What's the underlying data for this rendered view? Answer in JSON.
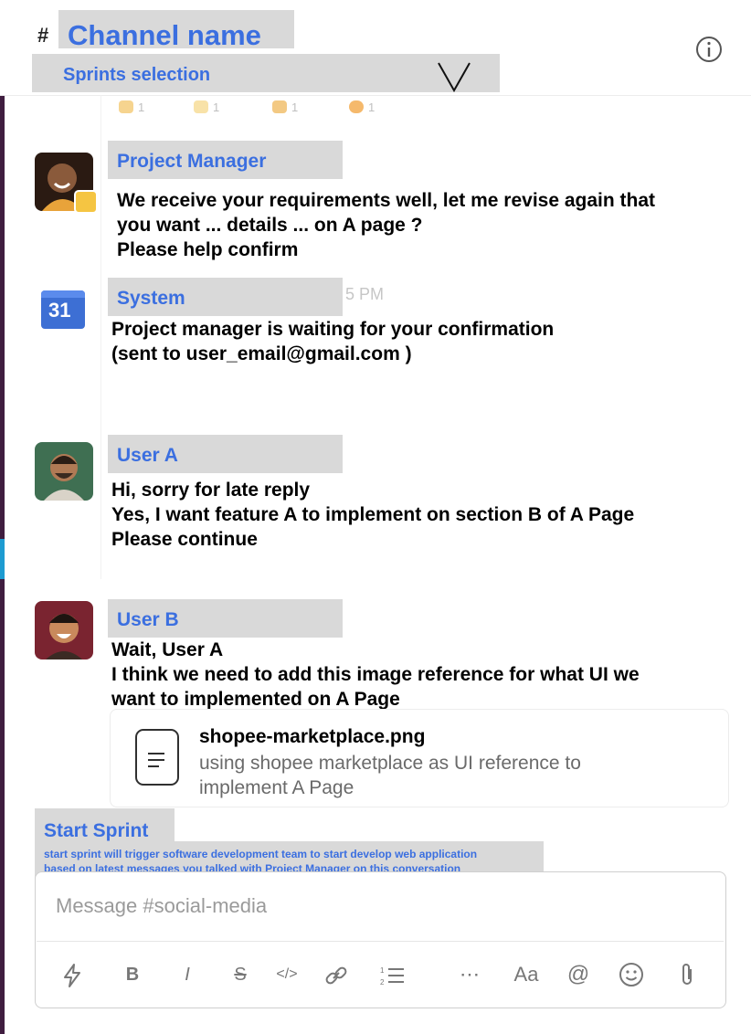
{
  "header": {
    "hash": "#",
    "channel_name": "Channel name",
    "sprints_selection": "Sprints selection"
  },
  "reactions": [
    "1",
    "1",
    "1",
    "1"
  ],
  "messages": [
    {
      "author": "Project Manager",
      "lines": [
        "We receive your requirements well, let me revise again that",
        "you want ... details ... on A page ?",
        "Please help confirm"
      ]
    },
    {
      "author": "System",
      "calendar_day": "31",
      "time_fragment": "5 PM",
      "lines": [
        "Project manager is waiting for your confirmation",
        "(sent to user_email@gmail.com )"
      ]
    },
    {
      "author": "User A",
      "lines": [
        "Hi, sorry for late reply",
        "Yes, I want feature A to implement on section B of A Page",
        "Please continue"
      ]
    },
    {
      "author": "User B",
      "lines": [
        "Wait, User A",
        "I think we need to add this image reference for what UI we",
        "want to implemented on A Page"
      ],
      "attachment": {
        "name": "shopee-marketplace.png",
        "desc": [
          "using shopee marketplace as UI reference to",
          "implement A Page"
        ]
      }
    }
  ],
  "start_sprint": {
    "label": "Start Sprint",
    "desc": [
      "start sprint will trigger software development team to start develop web application",
      "based on latest messages you talked with Project Manager on this conversation"
    ]
  },
  "composer": {
    "placeholder": "Message #social-media",
    "toolbar": [
      "B",
      "I",
      "S",
      "</>",
      "⋯",
      "Aa",
      "@"
    ]
  },
  "colors": {
    "accent": "#3b6fe0",
    "label_bg": "#d9d9d9"
  }
}
